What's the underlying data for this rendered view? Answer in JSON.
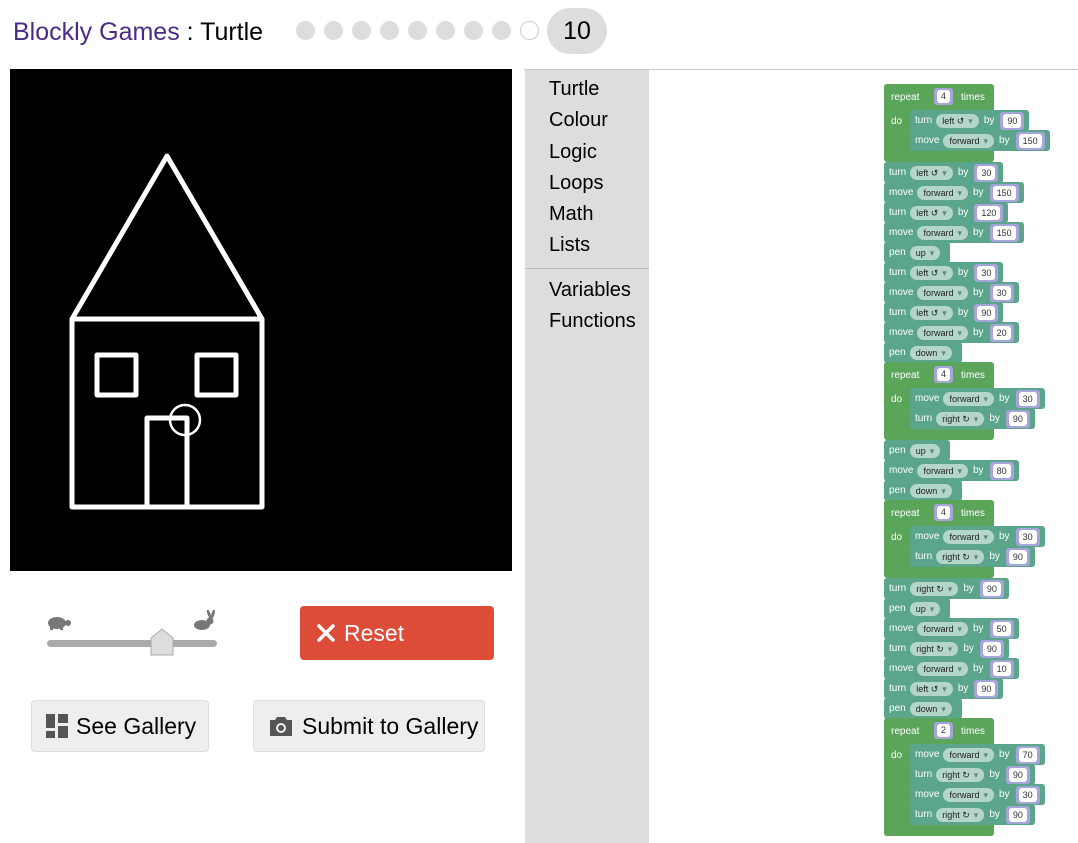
{
  "header": {
    "brand": "Blockly Games",
    "separator": " : ",
    "game": "Turtle",
    "level_current": "10",
    "levels_total": 9
  },
  "controls": {
    "reset_label": "Reset",
    "gallery_label": "See Gallery",
    "submit_label": "Submit to Gallery",
    "speed_level": 0.63
  },
  "toolbox": {
    "categories": [
      "Turtle",
      "Colour",
      "Logic",
      "Loops",
      "Math",
      "Lists"
    ],
    "categories_extra": [
      "Variables",
      "Functions"
    ]
  },
  "blocks": {
    "repeat_kw": "repeat",
    "times_kw": "times",
    "do_kw": "do",
    "turn_kw": "turn",
    "move_kw": "move",
    "pen_kw": "pen",
    "by_kw": "by",
    "program": [
      {
        "type": "repeat",
        "count": "4",
        "body": [
          {
            "cmd": "turn",
            "dir": "left ↺",
            "val": "90"
          },
          {
            "cmd": "move",
            "dir": "forward",
            "val": "150"
          }
        ]
      },
      {
        "cmd": "turn",
        "dir": "left ↺",
        "val": "30"
      },
      {
        "cmd": "move",
        "dir": "forward",
        "val": "150"
      },
      {
        "cmd": "turn",
        "dir": "left ↺",
        "val": "120"
      },
      {
        "cmd": "move",
        "dir": "forward",
        "val": "150"
      },
      {
        "cmd": "pen",
        "dir": "up"
      },
      {
        "cmd": "turn",
        "dir": "left ↺",
        "val": "30"
      },
      {
        "cmd": "move",
        "dir": "forward",
        "val": "30"
      },
      {
        "cmd": "turn",
        "dir": "left ↺",
        "val": "90"
      },
      {
        "cmd": "move",
        "dir": "forward",
        "val": "20"
      },
      {
        "cmd": "pen",
        "dir": "down"
      },
      {
        "type": "repeat",
        "count": "4",
        "body": [
          {
            "cmd": "move",
            "dir": "forward",
            "val": "30"
          },
          {
            "cmd": "turn",
            "dir": "right ↻",
            "val": "90"
          }
        ]
      },
      {
        "cmd": "pen",
        "dir": "up"
      },
      {
        "cmd": "move",
        "dir": "forward",
        "val": "80"
      },
      {
        "cmd": "pen",
        "dir": "down"
      },
      {
        "type": "repeat",
        "count": "4",
        "body": [
          {
            "cmd": "move",
            "dir": "forward",
            "val": "30"
          },
          {
            "cmd": "turn",
            "dir": "right ↻",
            "val": "90"
          }
        ]
      },
      {
        "cmd": "turn",
        "dir": "right ↻",
        "val": "90"
      },
      {
        "cmd": "pen",
        "dir": "up"
      },
      {
        "cmd": "move",
        "dir": "forward",
        "val": "50"
      },
      {
        "cmd": "turn",
        "dir": "right ↻",
        "val": "90"
      },
      {
        "cmd": "move",
        "dir": "forward",
        "val": "10"
      },
      {
        "cmd": "turn",
        "dir": "left ↺",
        "val": "90"
      },
      {
        "cmd": "pen",
        "dir": "down"
      },
      {
        "type": "repeat",
        "count": "2",
        "body": [
          {
            "cmd": "move",
            "dir": "forward",
            "val": "70"
          },
          {
            "cmd": "turn",
            "dir": "right ↻",
            "val": "90"
          },
          {
            "cmd": "move",
            "dir": "forward",
            "val": "30"
          },
          {
            "cmd": "turn",
            "dir": "right ↻",
            "val": "90"
          }
        ]
      }
    ]
  },
  "colors": {
    "brand": "#4a2a86",
    "reset_button": "#dd4b39",
    "loop_block": "#5ba55b",
    "turtle_block": "#5ba58c",
    "number_input": "#a5a5d9"
  },
  "icons": {
    "slow": "turtle-icon",
    "fast": "rabbit-icon",
    "reset": "close-icon",
    "gallery": "gallery-grid-icon",
    "submit": "camera-icon"
  }
}
